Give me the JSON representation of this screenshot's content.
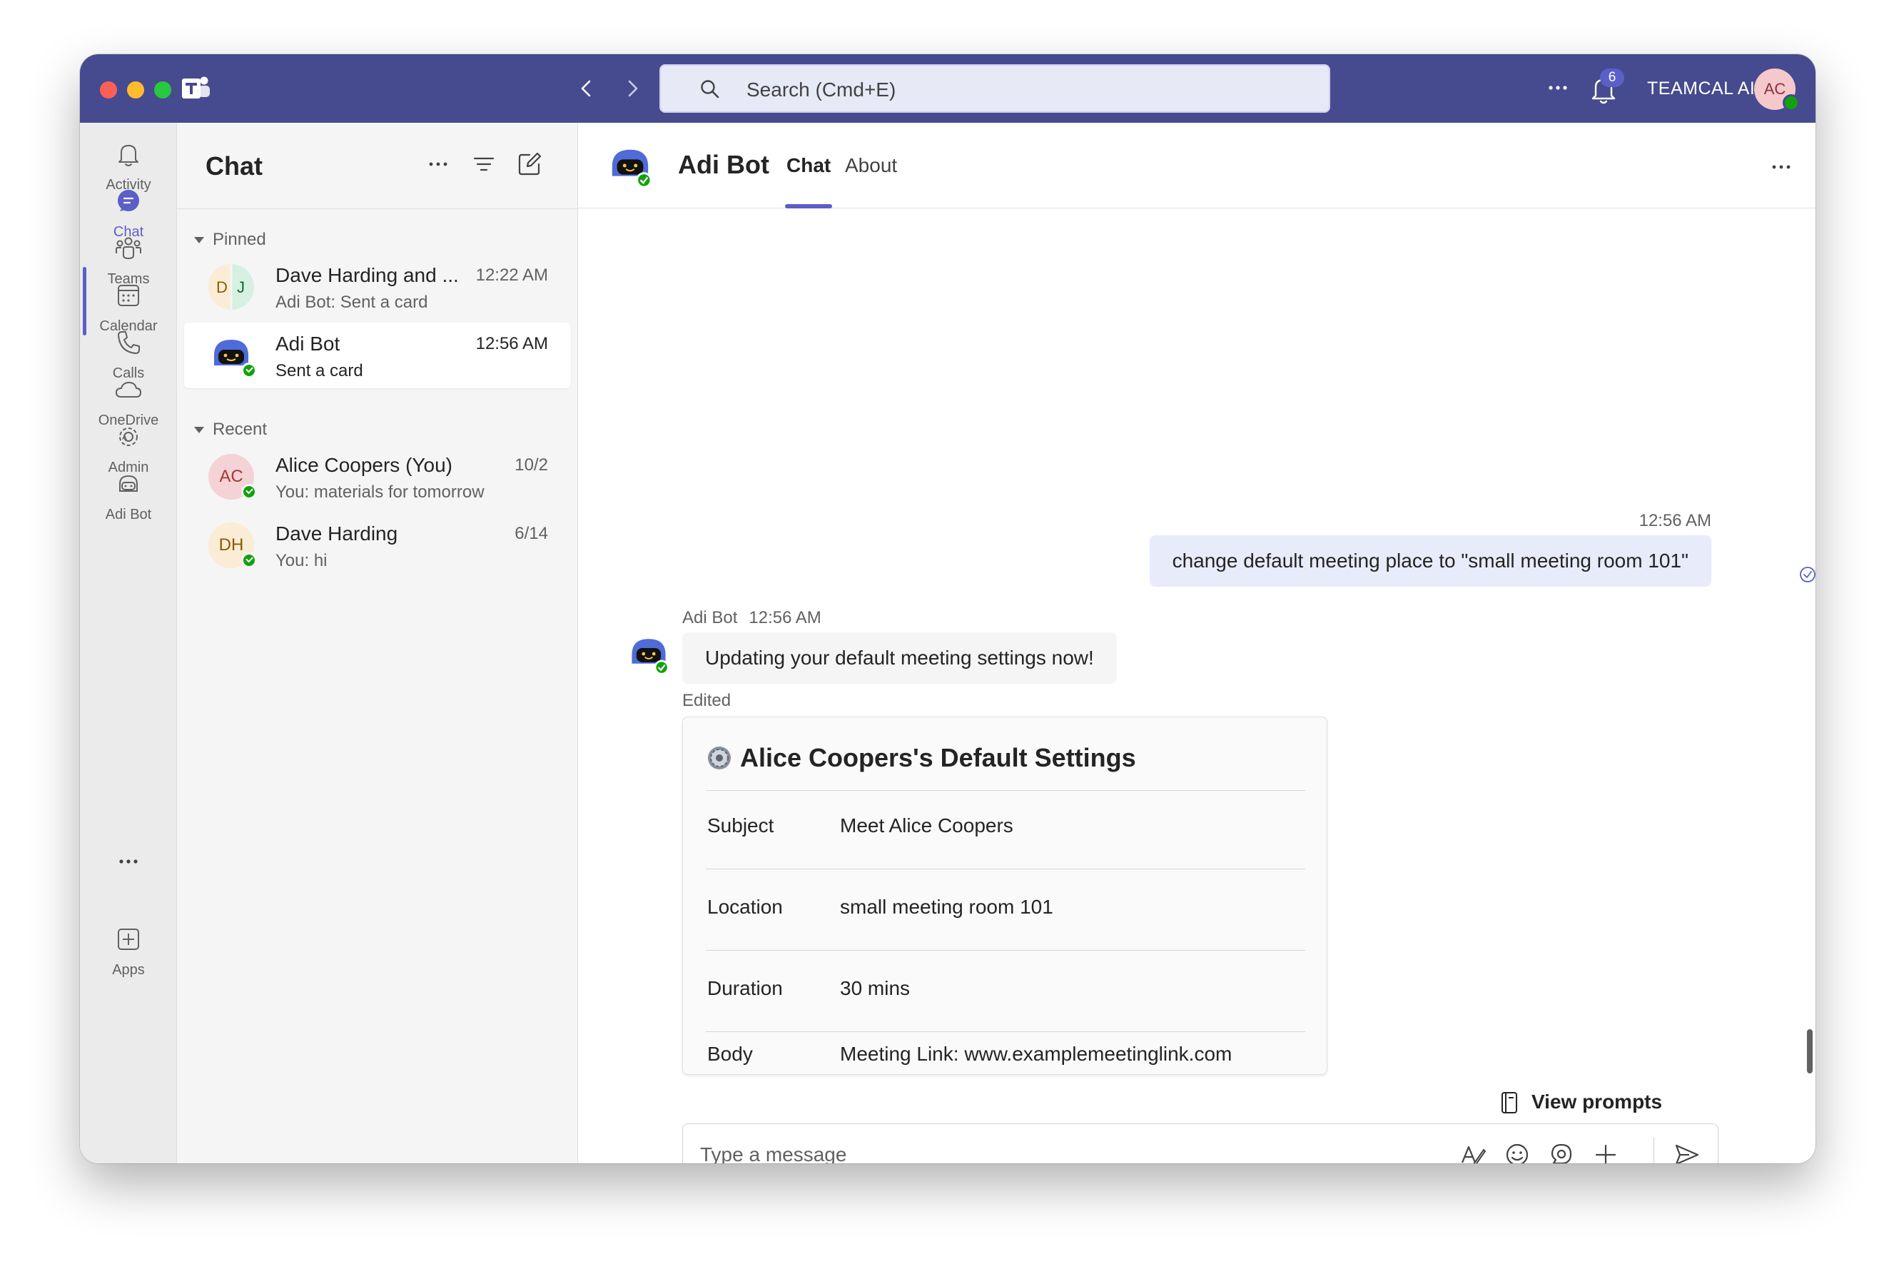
{
  "titlebar": {
    "search_placeholder": "Search (Cmd+E)",
    "notification_count": "6",
    "org_name": "TEAMCAL AI",
    "user_initials": "AC"
  },
  "rail": {
    "items": [
      {
        "label": "Activity",
        "icon": "bell-icon"
      },
      {
        "label": "Chat",
        "icon": "chat-icon"
      },
      {
        "label": "Teams",
        "icon": "teams-icon"
      },
      {
        "label": "Calendar",
        "icon": "calendar-icon"
      },
      {
        "label": "Calls",
        "icon": "phone-icon"
      },
      {
        "label": "OneDrive",
        "icon": "cloud-icon"
      },
      {
        "label": "Admin",
        "icon": "admin-icon"
      },
      {
        "label": "Adi Bot",
        "icon": "bot-icon"
      },
      {
        "label": "Apps",
        "icon": "add-app-icon"
      }
    ]
  },
  "chatlist": {
    "title": "Chat",
    "pinned_label": "Pinned",
    "recent_label": "Recent",
    "pinned": [
      {
        "name": "Dave Harding and ...",
        "time": "12:22 AM",
        "preview": "Adi Bot: Sent a card",
        "initials_left": "D",
        "initials_right": "J"
      },
      {
        "name": "Adi Bot",
        "time": "12:56 AM",
        "preview": "Sent a card"
      }
    ],
    "recent": [
      {
        "name": "Alice Coopers (You)",
        "time": "10/2",
        "preview": "You: materials for tomorrow",
        "initials": "AC"
      },
      {
        "name": "Dave Harding",
        "time": "6/14",
        "preview": "You: hi",
        "initials": "DH"
      }
    ]
  },
  "header": {
    "name": "Adi Bot",
    "tabs": [
      {
        "label": "Chat"
      },
      {
        "label": "About"
      }
    ]
  },
  "conversation": {
    "outgoing": {
      "time": "12:56 AM",
      "text": "change default meeting place to \"small meeting room 101\""
    },
    "incoming": {
      "sender": "Adi Bot",
      "time": "12:56 AM",
      "text": "Updating your default meeting settings now!",
      "edited_label": "Edited"
    },
    "card": {
      "title": "Alice Coopers's Default Settings",
      "rows": [
        {
          "key": "Subject",
          "value": "Meet Alice Coopers"
        },
        {
          "key": "Location",
          "value": "small meeting room 101"
        },
        {
          "key": "Duration",
          "value": "30 mins"
        },
        {
          "key": "Body",
          "value": "Meeting Link: www.examplemeetinglink.com"
        }
      ]
    }
  },
  "composer": {
    "view_prompts_label": "View prompts",
    "placeholder": "Type a message"
  },
  "colors": {
    "titlebar": "#464b8f",
    "accent": "#5b5fc7",
    "presence_available": "#13a10e"
  }
}
